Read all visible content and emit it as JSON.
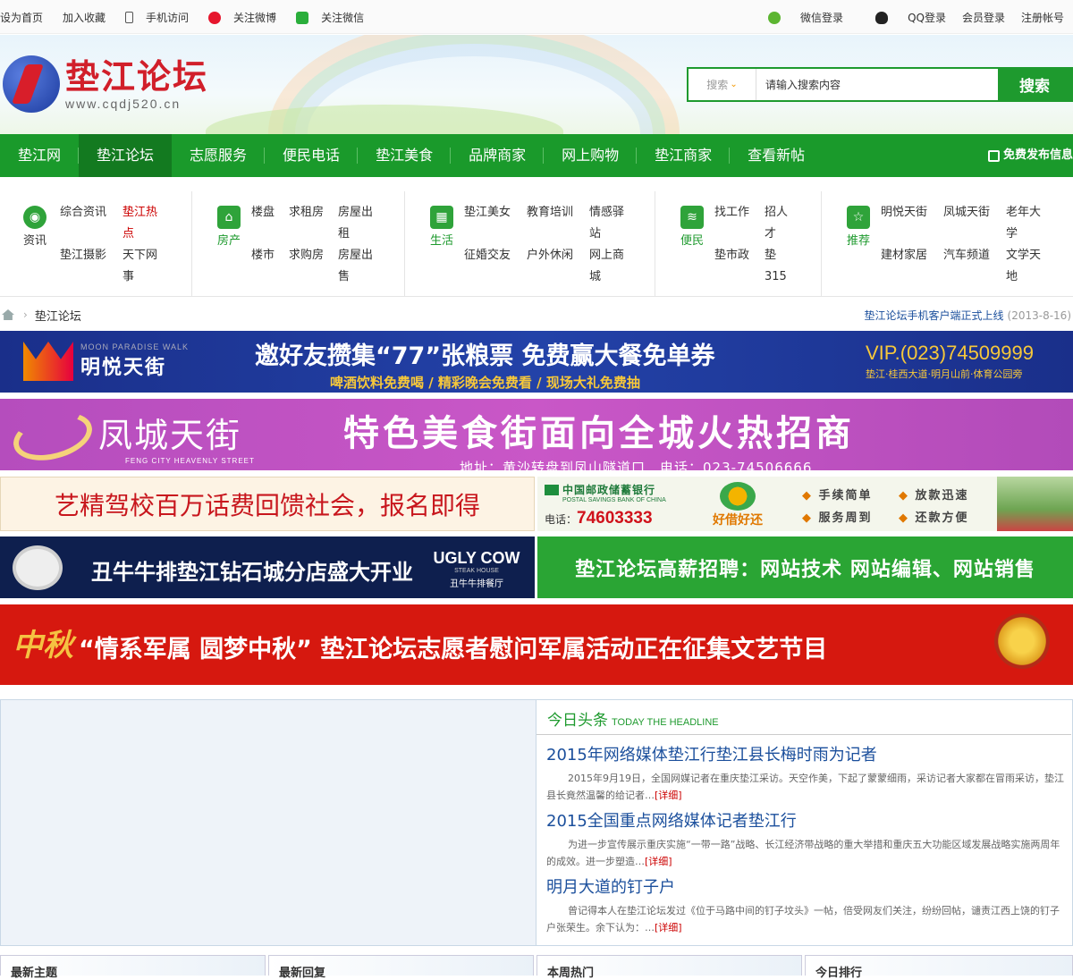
{
  "topbar": {
    "left": [
      "设为首页",
      "加入收藏",
      "手机访问",
      "关注微博",
      "关注微信"
    ],
    "right": [
      "微信登录",
      "QQ登录",
      "会员登录",
      "注册帐号"
    ]
  },
  "logo": {
    "cn": "垫江论坛",
    "en": "www.cqdj520.cn"
  },
  "search": {
    "select": "搜索",
    "placeholder": "请输入搜索内容",
    "button": "搜索"
  },
  "nav": {
    "items": [
      "垫江网",
      "垫江论坛",
      "志愿服务",
      "便民电话",
      "垫江美食",
      "品牌商家",
      "网上购物",
      "垫江商家",
      "查看新帖"
    ],
    "active": 1,
    "publish": "免费发布信息"
  },
  "categories": [
    {
      "label": "资讯",
      "links": [
        [
          "综合资讯",
          "垫江热点"
        ],
        [
          "垫江摄影",
          "天下网事"
        ]
      ]
    },
    {
      "label": "房产",
      "links": [
        [
          "楼盘",
          "求租房",
          "房屋出租"
        ],
        [
          "楼市",
          "求购房",
          "房屋出售"
        ]
      ]
    },
    {
      "label": "生活",
      "links": [
        [
          "垫江美女",
          "教育培训",
          "情感驿站"
        ],
        [
          "征婚交友",
          "户外休闲",
          "网上商城"
        ]
      ]
    },
    {
      "label": "便民",
      "links": [
        [
          "找工作",
          "招人才"
        ],
        [
          "垫市政",
          "垫315"
        ]
      ]
    },
    {
      "label": "推荐",
      "links": [
        [
          "明悦天街",
          "凤城天街",
          "老年大学"
        ],
        [
          "建材家居",
          "汽车频道",
          "文学天地"
        ]
      ]
    }
  ],
  "breadcrumb": {
    "current": "垫江论坛",
    "notice": "垫江论坛手机客户端正式上线",
    "notice_date": "(2013-8-16)"
  },
  "banners": {
    "b1": {
      "brand": "明悦天街",
      "brand_en": "MOON PARADISE WALK",
      "main": "邀好友攒集“77”张粮票 免费赢大餐免单券",
      "sub": "啤酒饮料免费喝 / 精彩晚会免费看 / 现场大礼免费抽",
      "vip": "VIP.(023)74509999",
      "addr": "垫江·桂西大道·明月山前·体育公园旁"
    },
    "b2": {
      "brand": "凤城天街",
      "brand_en": "FENG CITY HEAVENLY STREET",
      "main": "特色美食街面向全城火热招商",
      "sub": "地址：黄沙转盘到凤山隧道口　电话：023-74506666"
    },
    "b3": {
      "text": "艺精驾校百万话费回馈社会，报名即得"
    },
    "b4": {
      "bank": "中国邮政储蓄银行",
      "bank_en": "POSTAL SAVINGS BANK OF CHINA",
      "phone_label": "电话：",
      "phone": "74603333",
      "slogan": "好借好还",
      "f1": "手续简单",
      "f2": "放款迅速",
      "f3": "服务周到",
      "f4": "还款方便"
    },
    "b5": {
      "text": "丑牛牛排垫江钻石城分店盛大开业",
      "brand": "UGLY COW",
      "brand_sub": "STEAK HOUSE",
      "brand_cn": "丑牛牛排餐厅"
    },
    "b6": {
      "text": "垫江论坛高薪招聘：网站技术 网站编辑、网站销售"
    },
    "b7": {
      "mark": "中秋",
      "text": "“情系军属 圆梦中秋” 垫江论坛志愿者慰问军属活动正在征集文艺节目"
    }
  },
  "headline": {
    "title": "今日头条",
    "title_en": "TODAY THE HEADLINE",
    "articles": [
      {
        "title": "2015年网络媒体垫江行垫江县长梅时雨为记者",
        "summary": "2015年9月19日，全国网媒记者在重庆垫江采访。天空作美，下起了蒙蒙细雨，采访记者大家都在冒雨采访，垫江县长竟然温馨的给记者…",
        "more": "[详细]"
      },
      {
        "title": "2015全国重点网络媒体记者垫江行",
        "summary": "为进一步宣传展示重庆实施“一带一路”战略、长江经济带战略的重大举措和重庆五大功能区域发展战略实施两周年的成效。进一步塑造…",
        "more": "[详细]"
      },
      {
        "title": "明月大道的钉子户",
        "summary": "曾记得本人在垫江论坛发过《位于马路中间的钉子坟头》一帖，倍受网友们关注，纷纷回帖，谴责江西上饶的钉子户张荣生。余下认为：…",
        "more": "[详细]"
      }
    ]
  },
  "bottom_tabs": [
    "最新主题",
    "最新回复",
    "本周热门",
    "今日排行"
  ],
  "colors": {
    "green": "#1a9a2b",
    "blue": "#1b4f9c",
    "red": "#d11f2a"
  }
}
